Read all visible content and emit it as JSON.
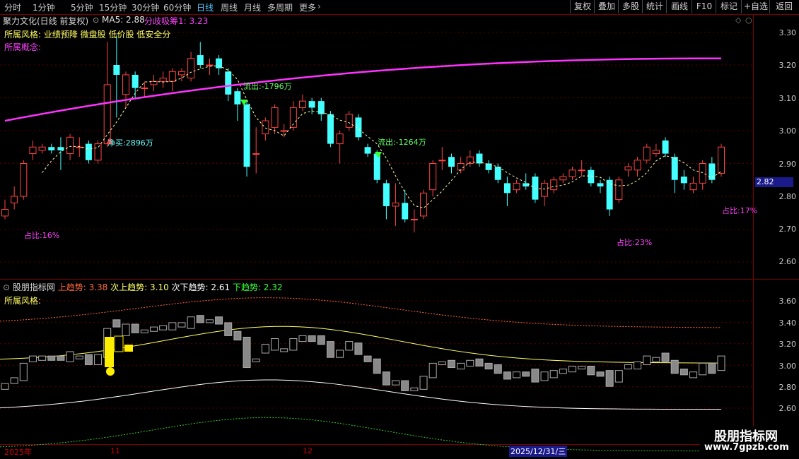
{
  "toolbar": {
    "periods": [
      "分时",
      "1分钟",
      "5分钟",
      "15分钟",
      "30分钟",
      "60分钟",
      "日线",
      "周线",
      "月线",
      "多周期",
      "更多"
    ],
    "active_period": "日线",
    "right_buttons": [
      "复权",
      "叠加",
      "多股",
      "统计",
      "画线",
      "F10",
      "标记",
      "+自选",
      "返回"
    ]
  },
  "main": {
    "stock_title": "聚力文化(日线 前复权)",
    "ma5_label": "MA5: 2.88",
    "fqxc_label": "分歧吸筹1: 3.23",
    "style_line": "所属风格: 业绩预降 微盘股 低价股 低安全分",
    "concept_line": "所属概念:",
    "price_tag": "2.82",
    "y_labels": [
      "3.30",
      "3.20",
      "3.10",
      "3.00",
      "2.90",
      "2.80",
      "2.70",
      "2.60"
    ],
    "annotations": {
      "net_buy": "净买:2896万",
      "outflow1": "流出:-1796万",
      "outflow2": "流出:-1264万",
      "ratio1": "占比:16%",
      "ratio2": "占比:23%",
      "ratio3": "占比:17%"
    }
  },
  "sub": {
    "title": "股朋指标网",
    "up_trend": "上趋势: 3.38",
    "sub_up_trend": "次上趋势: 3.10",
    "sub_down_trend": "次下趋势: 2.61",
    "down_trend": "下趋势: 2.32",
    "style_line": "所属风格:",
    "y_labels": [
      "3.60",
      "3.40",
      "3.20",
      "3.00",
      "2.80",
      "2.60"
    ]
  },
  "xaxis": {
    "labels": [
      "2025年",
      "11",
      "12"
    ],
    "highlight_date": "2025/12/31/三"
  },
  "watermark": {
    "line1": "股朋指标网",
    "line2": "www.7gpzb.com"
  },
  "colors": {
    "up": "#ff4444",
    "down": "#44ffff",
    "ma_line": "#ff33ff",
    "grid": "#5a0000"
  },
  "chart_data": {
    "type": "candlestick",
    "ylim": [
      2.55,
      3.35
    ],
    "candles": [
      {
        "o": 2.74,
        "c": 2.76,
        "h": 2.79,
        "l": 2.73
      },
      {
        "o": 2.78,
        "c": 2.8,
        "h": 2.83,
        "l": 2.76
      },
      {
        "o": 2.8,
        "c": 2.9,
        "h": 2.91,
        "l": 2.79
      },
      {
        "o": 2.93,
        "c": 2.95,
        "h": 2.97,
        "l": 2.91
      },
      {
        "o": 2.94,
        "c": 2.95,
        "h": 2.96,
        "l": 2.93
      },
      {
        "o": 2.95,
        "c": 2.94,
        "h": 2.96,
        "l": 2.93
      },
      {
        "o": 2.95,
        "c": 2.94,
        "h": 2.98,
        "l": 2.88
      },
      {
        "o": 2.93,
        "c": 2.98,
        "h": 2.99,
        "l": 2.91
      },
      {
        "o": 2.95,
        "c": 2.95,
        "h": 2.98,
        "l": 2.92
      },
      {
        "o": 2.96,
        "c": 2.91,
        "h": 2.97,
        "l": 2.9
      },
      {
        "o": 2.91,
        "c": 2.96,
        "h": 2.97,
        "l": 2.9
      },
      {
        "o": 2.96,
        "c": 3.14,
        "h": 3.27,
        "l": 2.95
      },
      {
        "o": 3.2,
        "c": 3.17,
        "h": 3.29,
        "l": 3.04
      },
      {
        "o": 3.11,
        "c": 3.17,
        "h": 3.18,
        "l": 3.07
      },
      {
        "o": 3.17,
        "c": 3.13,
        "h": 3.18,
        "l": 3.1
      },
      {
        "o": 3.13,
        "c": 3.13,
        "h": 3.15,
        "l": 3.1
      },
      {
        "o": 3.14,
        "c": 3.15,
        "h": 3.17,
        "l": 3.12
      },
      {
        "o": 3.15,
        "c": 3.16,
        "h": 3.18,
        "l": 3.13
      },
      {
        "o": 3.15,
        "c": 3.18,
        "h": 3.19,
        "l": 3.12
      },
      {
        "o": 3.17,
        "c": 3.18,
        "h": 3.19,
        "l": 3.15
      },
      {
        "o": 3.16,
        "c": 3.22,
        "h": 3.24,
        "l": 3.15
      },
      {
        "o": 3.23,
        "c": 3.2,
        "h": 3.27,
        "l": 3.19
      },
      {
        "o": 3.2,
        "c": 3.2,
        "h": 3.22,
        "l": 3.17
      },
      {
        "o": 3.22,
        "c": 3.19,
        "h": 3.23,
        "l": 3.17
      },
      {
        "o": 3.18,
        "c": 3.11,
        "h": 3.19,
        "l": 3.09
      },
      {
        "o": 3.12,
        "c": 3.08,
        "h": 3.13,
        "l": 3.03
      },
      {
        "o": 3.08,
        "c": 2.89,
        "h": 3.09,
        "l": 2.86
      },
      {
        "o": 2.93,
        "c": 2.93,
        "h": 3.01,
        "l": 2.87
      },
      {
        "o": 2.99,
        "c": 3.03,
        "h": 3.04,
        "l": 2.97
      },
      {
        "o": 3.01,
        "c": 3.07,
        "h": 3.08,
        "l": 2.99
      },
      {
        "o": 3.0,
        "c": 3.0,
        "h": 3.02,
        "l": 2.98
      },
      {
        "o": 3.01,
        "c": 3.07,
        "h": 3.09,
        "l": 3.0
      },
      {
        "o": 3.07,
        "c": 3.09,
        "h": 3.11,
        "l": 3.06
      },
      {
        "o": 3.09,
        "c": 3.07,
        "h": 3.1,
        "l": 3.05
      },
      {
        "o": 3.09,
        "c": 3.05,
        "h": 3.1,
        "l": 3.03
      },
      {
        "o": 3.05,
        "c": 2.96,
        "h": 3.06,
        "l": 2.95
      },
      {
        "o": 2.96,
        "c": 2.99,
        "h": 3.0,
        "l": 2.9
      },
      {
        "o": 3.01,
        "c": 3.05,
        "h": 3.06,
        "l": 3.0
      },
      {
        "o": 3.04,
        "c": 2.98,
        "h": 3.05,
        "l": 2.97
      },
      {
        "o": 2.95,
        "c": 2.93,
        "h": 2.96,
        "l": 2.92
      },
      {
        "o": 2.93,
        "c": 2.85,
        "h": 2.94,
        "l": 2.84
      },
      {
        "o": 2.84,
        "c": 2.77,
        "h": 2.85,
        "l": 2.73
      },
      {
        "o": 2.77,
        "c": 2.78,
        "h": 2.84,
        "l": 2.71
      },
      {
        "o": 2.78,
        "c": 2.73,
        "h": 2.82,
        "l": 2.72
      },
      {
        "o": 2.73,
        "c": 2.73,
        "h": 2.76,
        "l": 2.69
      },
      {
        "o": 2.74,
        "c": 2.81,
        "h": 2.82,
        "l": 2.73
      },
      {
        "o": 2.82,
        "c": 2.9,
        "h": 2.91,
        "l": 2.8
      },
      {
        "o": 2.91,
        "c": 2.91,
        "h": 2.95,
        "l": 2.88
      },
      {
        "o": 2.92,
        "c": 2.89,
        "h": 2.93,
        "l": 2.87
      },
      {
        "o": 2.88,
        "c": 2.9,
        "h": 2.92,
        "l": 2.87
      },
      {
        "o": 2.9,
        "c": 2.92,
        "h": 2.94,
        "l": 2.89
      },
      {
        "o": 2.93,
        "c": 2.9,
        "h": 2.94,
        "l": 2.89
      },
      {
        "o": 2.9,
        "c": 2.88,
        "h": 2.91,
        "l": 2.87
      },
      {
        "o": 2.89,
        "c": 2.85,
        "h": 2.9,
        "l": 2.84
      },
      {
        "o": 2.84,
        "c": 2.81,
        "h": 2.86,
        "l": 2.77
      },
      {
        "o": 2.82,
        "c": 2.84,
        "h": 2.85,
        "l": 2.81
      },
      {
        "o": 2.84,
        "c": 2.83,
        "h": 2.87,
        "l": 2.82
      },
      {
        "o": 2.86,
        "c": 2.79,
        "h": 2.87,
        "l": 2.78
      },
      {
        "o": 2.8,
        "c": 2.84,
        "h": 2.85,
        "l": 2.77
      },
      {
        "o": 2.82,
        "c": 2.85,
        "h": 2.86,
        "l": 2.81
      },
      {
        "o": 2.85,
        "c": 2.86,
        "h": 2.87,
        "l": 2.84
      },
      {
        "o": 2.86,
        "c": 2.88,
        "h": 2.89,
        "l": 2.85
      },
      {
        "o": 2.88,
        "c": 2.88,
        "h": 2.91,
        "l": 2.86
      },
      {
        "o": 2.88,
        "c": 2.84,
        "h": 2.89,
        "l": 2.83
      },
      {
        "o": 2.84,
        "c": 2.83,
        "h": 2.85,
        "l": 2.81
      },
      {
        "o": 2.85,
        "c": 2.76,
        "h": 2.86,
        "l": 2.74
      },
      {
        "o": 2.79,
        "c": 2.85,
        "h": 2.86,
        "l": 2.78
      },
      {
        "o": 2.88,
        "c": 2.89,
        "h": 2.9,
        "l": 2.86
      },
      {
        "o": 2.88,
        "c": 2.91,
        "h": 2.92,
        "l": 2.86
      },
      {
        "o": 2.91,
        "c": 2.95,
        "h": 2.96,
        "l": 2.9
      },
      {
        "o": 2.93,
        "c": 2.94,
        "h": 2.96,
        "l": 2.92
      },
      {
        "o": 2.97,
        "c": 2.93,
        "h": 2.98,
        "l": 2.92
      },
      {
        "o": 2.92,
        "c": 2.85,
        "h": 2.93,
        "l": 2.81
      },
      {
        "o": 2.86,
        "c": 2.84,
        "h": 2.88,
        "l": 2.82
      },
      {
        "o": 2.82,
        "c": 2.84,
        "h": 2.86,
        "l": 2.81
      },
      {
        "o": 2.84,
        "c": 2.9,
        "h": 2.91,
        "l": 2.82
      },
      {
        "o": 2.9,
        "c": 2.85,
        "h": 2.92,
        "l": 2.84
      },
      {
        "o": 2.87,
        "c": 2.95,
        "h": 2.96,
        "l": 2.86
      }
    ],
    "ma_fqxc": {
      "start": 3.03,
      "end": 3.22
    }
  }
}
